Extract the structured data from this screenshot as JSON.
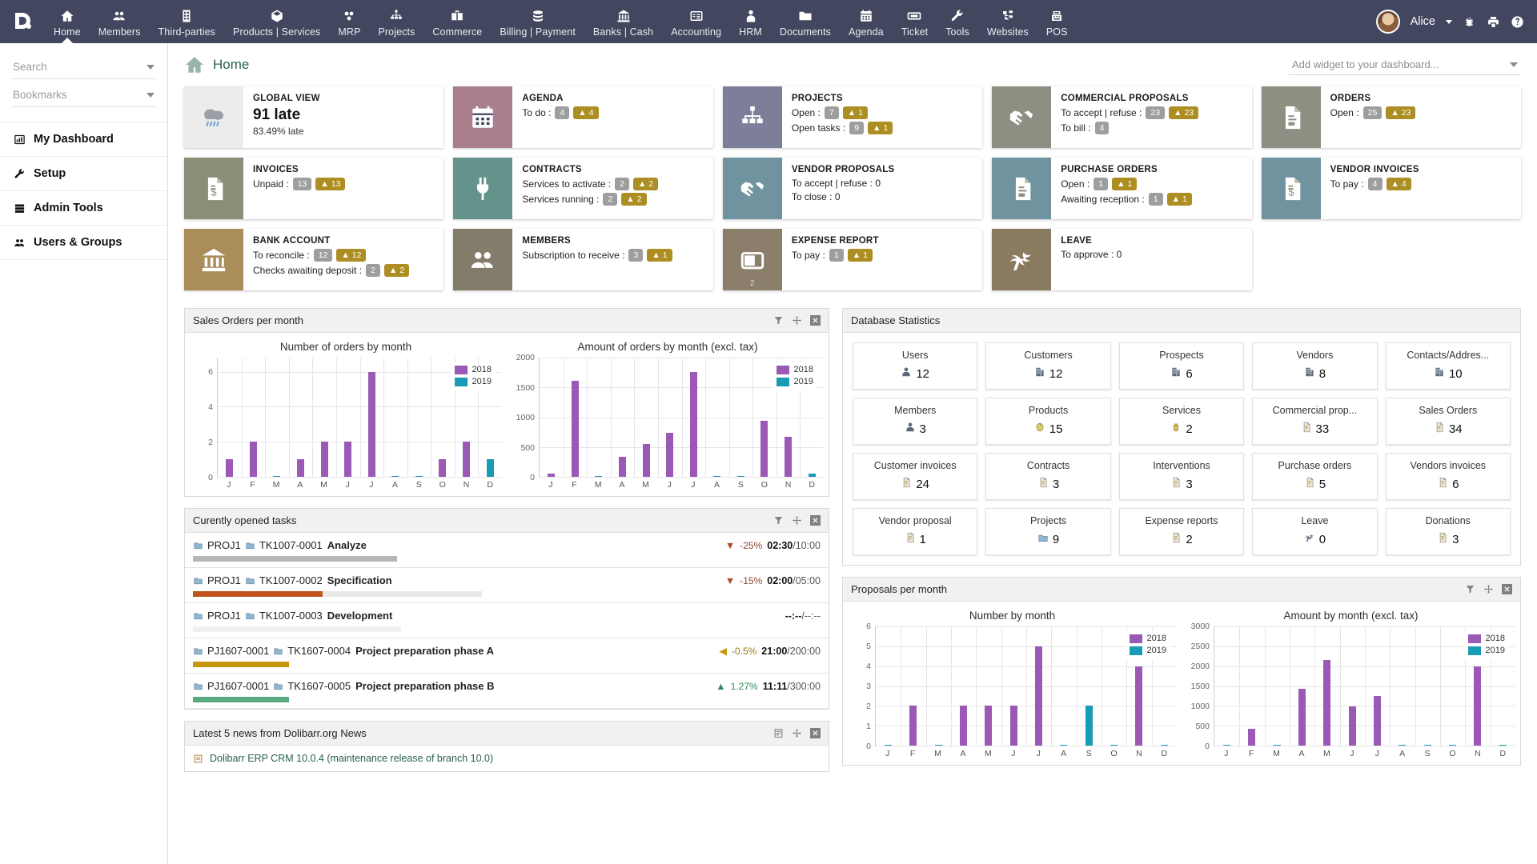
{
  "app": {
    "logo_letter": "D"
  },
  "topnav": {
    "items": [
      {
        "label": "Home",
        "icon": "home-icon",
        "active": true
      },
      {
        "label": "Members",
        "icon": "members-icon",
        "active": false
      },
      {
        "label": "Third-parties",
        "icon": "building-icon",
        "active": false
      },
      {
        "label": "Products | Services",
        "icon": "box-icon",
        "active": false
      },
      {
        "label": "MRP",
        "icon": "mrp-icon",
        "active": false
      },
      {
        "label": "Projects",
        "icon": "project-tree-icon",
        "active": false
      },
      {
        "label": "Commerce",
        "icon": "briefcase-icon",
        "active": false
      },
      {
        "label": "Billing | Payment",
        "icon": "coins-icon",
        "active": false
      },
      {
        "label": "Banks | Cash",
        "icon": "bank-icon",
        "active": false
      },
      {
        "label": "Accounting",
        "icon": "accounting-icon",
        "active": false
      },
      {
        "label": "HRM",
        "icon": "user-tie-icon",
        "active": false
      },
      {
        "label": "Documents",
        "icon": "folder-icon",
        "active": false
      },
      {
        "label": "Agenda",
        "icon": "calendar-icon",
        "active": false
      },
      {
        "label": "Ticket",
        "icon": "ticket-icon",
        "active": false
      },
      {
        "label": "Tools",
        "icon": "wrench-icon",
        "active": false
      },
      {
        "label": "Websites",
        "icon": "sitemap-icon",
        "active": false
      },
      {
        "label": "POS",
        "icon": "cash-register-icon",
        "active": false
      }
    ],
    "user": "Alice",
    "right_icons": [
      "bug-icon",
      "print-icon",
      "help-icon"
    ]
  },
  "sidebar": {
    "search_placeholder": "Search",
    "bookmarks_placeholder": "Bookmarks",
    "items": [
      {
        "label": "My Dashboard",
        "icon": "chart-bar-icon"
      },
      {
        "label": "Setup",
        "icon": "wrench-icon"
      },
      {
        "label": "Admin Tools",
        "icon": "server-icon"
      },
      {
        "label": "Users & Groups",
        "icon": "users-icon"
      }
    ]
  },
  "page": {
    "title": "Home",
    "widget_select_placeholder": "Add widget to your dashboard..."
  },
  "cards": [
    {
      "title": "GLOBAL VIEW",
      "icon": "weather-rain-icon",
      "color": "#ececec",
      "big": "91 late",
      "sub": "83.49% late",
      "lines": []
    },
    {
      "title": "AGENDA",
      "icon": "calendar-icon",
      "color": "#a97f8e",
      "lines": [
        {
          "label": "To do :",
          "count": "4",
          "warn": "4"
        }
      ]
    },
    {
      "title": "PROJECTS",
      "icon": "project-tree-icon",
      "color": "#7d7e99",
      "lines": [
        {
          "label": "Open :",
          "count": "7",
          "warn": "1"
        },
        {
          "label": "Open tasks :",
          "count": "9",
          "warn": "1"
        }
      ]
    },
    {
      "title": "COMMERCIAL PROPOSALS",
      "icon": "handshake-icon",
      "color": "#8b9082",
      "lines": [
        {
          "label": "To accept | refuse :",
          "count": "23",
          "warn": "23"
        },
        {
          "label": "To bill :",
          "count": "4",
          "warn": ""
        }
      ]
    },
    {
      "title": "ORDERS",
      "icon": "order-doc-icon",
      "color": "#8b9082",
      "lines": [
        {
          "label": "Open :",
          "count": "25",
          "warn": "23"
        }
      ]
    },
    {
      "title": "INVOICES",
      "icon": "invoice-icon",
      "color": "#8b8e76",
      "lines": [
        {
          "label": "Unpaid :",
          "count": "13",
          "warn": "13"
        }
      ]
    },
    {
      "title": "CONTRACTS",
      "icon": "plug-icon",
      "color": "#63938b",
      "lines": [
        {
          "label": "Services to activate :",
          "count": "2",
          "warn": "2"
        },
        {
          "label": "Services running :",
          "count": "2",
          "warn": "2"
        }
      ]
    },
    {
      "title": "VENDOR PROPOSALS",
      "icon": "handshake-icon",
      "color": "#6f94a0",
      "lines": [
        {
          "label": "To accept | refuse : 0",
          "count": "",
          "warn": ""
        },
        {
          "label": "To close : 0",
          "count": "",
          "warn": ""
        }
      ]
    },
    {
      "title": "PURCHASE ORDERS",
      "icon": "order-doc-icon",
      "color": "#6f94a0",
      "lines": [
        {
          "label": "Open :",
          "count": "1",
          "warn": "1"
        },
        {
          "label": "Awaiting reception :",
          "count": "1",
          "warn": "1"
        }
      ]
    },
    {
      "title": "VENDOR INVOICES",
      "icon": "invoice-icon",
      "color": "#6f94a0",
      "lines": [
        {
          "label": "To pay :",
          "count": "4",
          "warn": "4"
        }
      ]
    },
    {
      "title": "BANK ACCOUNT",
      "icon": "bank-icon",
      "color": "#ab8d5a",
      "lines": [
        {
          "label": "To reconcile :",
          "count": "12",
          "warn": "12"
        },
        {
          "label": "Checks awaiting deposit :",
          "count": "2",
          "warn": "2"
        }
      ]
    },
    {
      "title": "MEMBERS",
      "icon": "members-icon",
      "color": "#847c6a",
      "lines": [
        {
          "label": "Subscription to receive :",
          "count": "3",
          "warn": "1"
        }
      ]
    },
    {
      "title": "EXPENSE REPORT",
      "icon": "wallet-icon",
      "color": "#8b7f6b",
      "corner": "2",
      "lines": [
        {
          "label": "To pay :",
          "count": "1",
          "warn": "1"
        }
      ]
    },
    {
      "title": "LEAVE",
      "icon": "palm-icon",
      "color": "#8a7a5f",
      "lines": [
        {
          "label": "To approve : 0",
          "count": "",
          "warn": ""
        }
      ]
    }
  ],
  "panels": {
    "sales_orders_title": "Sales Orders per month",
    "db_stats_title": "Database Statistics",
    "tasks_title": "Curently opened tasks",
    "proposals_title": "Proposals per month",
    "news_title": "Latest 5 news from Dolibarr.org News",
    "news_first": "Dolibarr ERP CRM 10.0.4 (maintenance release of branch 10.0)"
  },
  "chart_data": [
    {
      "type": "bar",
      "title": "Number of orders by month",
      "categories": [
        "J",
        "F",
        "M",
        "A",
        "M",
        "J",
        "J",
        "A",
        "S",
        "O",
        "N",
        "D"
      ],
      "series": [
        {
          "name": "2018",
          "color": "#9B59B6",
          "values": [
            1,
            2,
            0,
            1,
            2,
            2,
            6,
            0,
            0,
            1,
            2,
            0
          ]
        },
        {
          "name": "2019",
          "color": "#1A9BB5",
          "values": [
            0,
            0,
            0,
            0,
            0,
            0,
            0,
            0,
            0,
            0,
            0,
            1
          ]
        }
      ],
      "ylim": [
        0,
        6.8
      ],
      "yticks": [
        0,
        2,
        4,
        6
      ],
      "xlabel": "",
      "ylabel": "",
      "grid": true,
      "legend": "top-right"
    },
    {
      "type": "bar",
      "title": "Amount of orders by month (excl. tax)",
      "categories": [
        "J",
        "F",
        "M",
        "A",
        "M",
        "J",
        "J",
        "A",
        "S",
        "O",
        "N",
        "D"
      ],
      "series": [
        {
          "name": "2018",
          "color": "#9B59B6",
          "values": [
            50,
            1610,
            0,
            340,
            550,
            735,
            1760,
            0,
            0,
            935,
            665,
            0
          ]
        },
        {
          "name": "2019",
          "color": "#1A9BB5",
          "values": [
            0,
            0,
            0,
            0,
            0,
            0,
            0,
            0,
            0,
            0,
            0,
            50
          ]
        }
      ],
      "ylim": [
        0,
        2000
      ],
      "yticks": [
        0,
        500,
        1000,
        1500,
        2000
      ],
      "xlabel": "",
      "ylabel": "",
      "grid": true,
      "legend": "top-right"
    },
    {
      "type": "bar",
      "title": "Number by month",
      "categories": [
        "J",
        "F",
        "M",
        "A",
        "M",
        "J",
        "J",
        "A",
        "S",
        "O",
        "N",
        "D"
      ],
      "series": [
        {
          "name": "2018",
          "color": "#9B59B6",
          "values": [
            0,
            2,
            0,
            2,
            2,
            2,
            5,
            0,
            0,
            0,
            4,
            0
          ]
        },
        {
          "name": "2019",
          "color": "#1A9BB5",
          "values": [
            0,
            0,
            0,
            0,
            0,
            0,
            0,
            0,
            2,
            0,
            0,
            0
          ]
        }
      ],
      "ylim": [
        0,
        6
      ],
      "yticks": [
        0,
        1,
        2,
        3,
        4,
        5,
        6
      ],
      "xlabel": "",
      "ylabel": "",
      "grid": true,
      "legend": "top-right"
    },
    {
      "type": "bar",
      "title": "Amount by month (excl. tax)",
      "categories": [
        "J",
        "F",
        "M",
        "A",
        "M",
        "J",
        "J",
        "A",
        "S",
        "O",
        "N",
        "D"
      ],
      "series": [
        {
          "name": "2018",
          "color": "#9B59B6",
          "values": [
            0,
            430,
            0,
            1430,
            2150,
            980,
            1250,
            0,
            0,
            0,
            2000,
            0
          ]
        },
        {
          "name": "2019",
          "color": "#1A9BB5",
          "values": [
            0,
            0,
            0,
            0,
            0,
            0,
            0,
            0,
            0,
            0,
            0,
            0
          ]
        }
      ],
      "ylim": [
        0,
        3000
      ],
      "yticks": [
        0,
        500,
        1000,
        1500,
        2000,
        2500,
        3000
      ],
      "xlabel": "",
      "ylabel": "",
      "grid": true,
      "legend": "top-right"
    }
  ],
  "db_stats": [
    {
      "label": "Users",
      "value": "12",
      "icon": "user-icon"
    },
    {
      "label": "Customers",
      "value": "12",
      "icon": "company-icon"
    },
    {
      "label": "Prospects",
      "value": "6",
      "icon": "company-icon"
    },
    {
      "label": "Vendors",
      "value": "8",
      "icon": "company-icon"
    },
    {
      "label": "Contacts/Addres...",
      "value": "10",
      "icon": "company-icon"
    },
    {
      "label": "Members",
      "value": "3",
      "icon": "user-icon"
    },
    {
      "label": "Products",
      "value": "15",
      "icon": "product-icon"
    },
    {
      "label": "Services",
      "value": "2",
      "icon": "service-icon"
    },
    {
      "label": "Commercial prop...",
      "value": "33",
      "icon": "doc-icon"
    },
    {
      "label": "Sales Orders",
      "value": "34",
      "icon": "doc-icon"
    },
    {
      "label": "Customer invoices",
      "value": "24",
      "icon": "doc-icon"
    },
    {
      "label": "Contracts",
      "value": "3",
      "icon": "doc-icon"
    },
    {
      "label": "Interventions",
      "value": "3",
      "icon": "doc-icon"
    },
    {
      "label": "Purchase orders",
      "value": "5",
      "icon": "doc-icon"
    },
    {
      "label": "Vendors invoices",
      "value": "6",
      "icon": "doc-icon"
    },
    {
      "label": "Vendor proposal",
      "value": "1",
      "icon": "doc-icon"
    },
    {
      "label": "Projects",
      "value": "9",
      "icon": "project-icon"
    },
    {
      "label": "Expense reports",
      "value": "2",
      "icon": "doc-icon"
    },
    {
      "label": "Leave",
      "value": "0",
      "icon": "palm-icon"
    },
    {
      "label": "Donations",
      "value": "3",
      "icon": "doc-icon"
    }
  ],
  "tasks": [
    {
      "project": "PROJ1",
      "ref": "TK1007-0001",
      "name": "Analyze",
      "pct": "-25%",
      "dir": "down",
      "spent": "02:30",
      "planned": "10:00",
      "progress": 58,
      "bar_color": "#b6b6b6"
    },
    {
      "project": "PROJ1",
      "ref": "TK1007-0002",
      "name": "Specification",
      "pct": "-15%",
      "dir": "down",
      "spent": "02:00",
      "planned": "05:00",
      "progress": 82,
      "bar_color": "#c0511a",
      "fill": 45
    },
    {
      "project": "PROJ1",
      "ref": "TK1007-0003",
      "name": "Development",
      "pct": "",
      "dir": "none",
      "spent": "--:--",
      "planned": "--:--",
      "progress": 0,
      "bar_color": "#e9e9e9"
    },
    {
      "project": "PJ1607-0001",
      "ref": "TK1607-0004",
      "name": "Project preparation phase A",
      "pct": "-0.5%",
      "dir": "left",
      "spent": "21:00",
      "planned": "200:00",
      "progress": 22,
      "bar_color": "#c8960c"
    },
    {
      "project": "PJ1607-0001",
      "ref": "TK1607-0005",
      "name": "Project preparation phase B",
      "pct": "1.27%",
      "dir": "up",
      "spent": "11:11",
      "planned": "300:00",
      "progress": 10,
      "bar_color": "#5aa882"
    }
  ]
}
